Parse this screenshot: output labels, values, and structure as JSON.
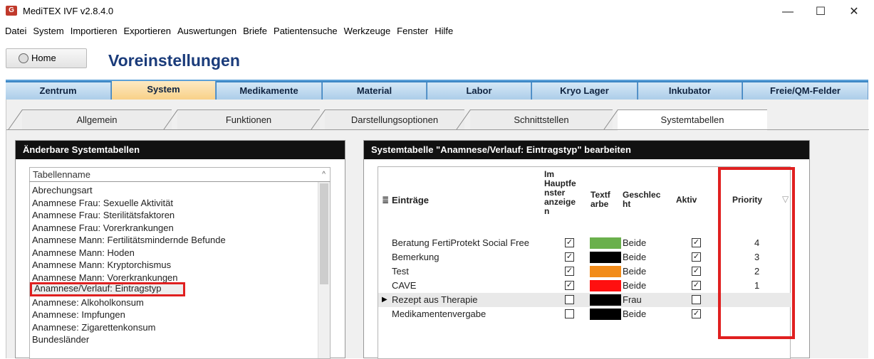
{
  "window": {
    "title": "MediTEX IVF v2.8.4.0",
    "minimize": "—",
    "maximize": "☐",
    "close": "✕",
    "app_icon": "G"
  },
  "menu": [
    "Datei",
    "System",
    "Importieren",
    "Exportieren",
    "Auswertungen",
    "Briefe",
    "Patientensuche",
    "Werkzeuge",
    "Fenster",
    "Hilfe"
  ],
  "home_label": "Home",
  "page_title": "Voreinstellungen",
  "main_tabs": [
    "Zentrum",
    "System",
    "Medikamente",
    "Material",
    "Labor",
    "Kryo Lager",
    "Inkubator",
    "Freie/QM-Felder"
  ],
  "active_main_tab": "System",
  "sub_tabs": [
    "Allgemein",
    "Funktionen",
    "Darstellungsoptionen",
    "Schnittstellen",
    "Systemtabellen"
  ],
  "active_sub_tab": "Systemtabellen",
  "left_panel": {
    "header": "Änderbare Systemtabellen",
    "column": "Tabellenname",
    "sort_glyph": "^",
    "items": [
      "Abrechungsart",
      "Anamnese Frau: Sexuelle Aktivität",
      "Anamnese Frau: Sterilitätsfaktoren",
      "Anamnese Frau: Vorerkrankungen",
      "Anamnese Mann: Fertilitätsmindernde Befunde",
      "Anamnese Mann: Hoden",
      "Anamnese Mann: Kryptorchismus",
      "Anamnese Mann: Vorerkrankungen",
      "Anamnese/Verlauf: Eintragstyp",
      "Anamnese: Alkoholkonsum",
      "Anamnese: Impfungen",
      "Anamnese: Zigarettenkonsum",
      "Bundesländer"
    ],
    "selected": "Anamnese/Verlauf: Eintragstyp"
  },
  "right_panel": {
    "header": "Systemtabelle \"Anamnese/Verlauf: Eintragstyp\" bearbeiten",
    "columns": {
      "eintraege": "Einträge",
      "hauptfenster": [
        "Im",
        "Hauptfe",
        "nster",
        "anzeige",
        "n"
      ],
      "textfarbe": [
        "Textf",
        "arbe"
      ],
      "geschlecht": [
        "Geschlec",
        "ht"
      ],
      "aktiv": "Aktiv",
      "priority": "Priority",
      "filter_glyph": "▽"
    },
    "rows": [
      {
        "name": "Beratung FertiProtekt  Social Free",
        "main": true,
        "color": "#6ab04c",
        "gender": "Beide",
        "active": true,
        "priority": "4"
      },
      {
        "name": "Bemerkung",
        "main": true,
        "color": "#000000",
        "gender": "Beide",
        "active": true,
        "priority": "3"
      },
      {
        "name": "Test",
        "main": true,
        "color": "#f28c1a",
        "gender": "Beide",
        "active": true,
        "priority": "2"
      },
      {
        "name": "CAVE",
        "main": true,
        "color": "#ff1010",
        "gender": "Beide",
        "active": true,
        "priority": "1"
      },
      {
        "name": "Rezept aus Therapie",
        "main": false,
        "color": "#000000",
        "gender": "Frau",
        "active": false,
        "priority": ""
      },
      {
        "name": "Medikamentenvergabe",
        "main": false,
        "color": "#000000",
        "gender": "Beide",
        "active": true,
        "priority": ""
      }
    ],
    "current_row": "Rezept aus Therapie",
    "row_marker": "▶",
    "check_glyph": "✓"
  }
}
